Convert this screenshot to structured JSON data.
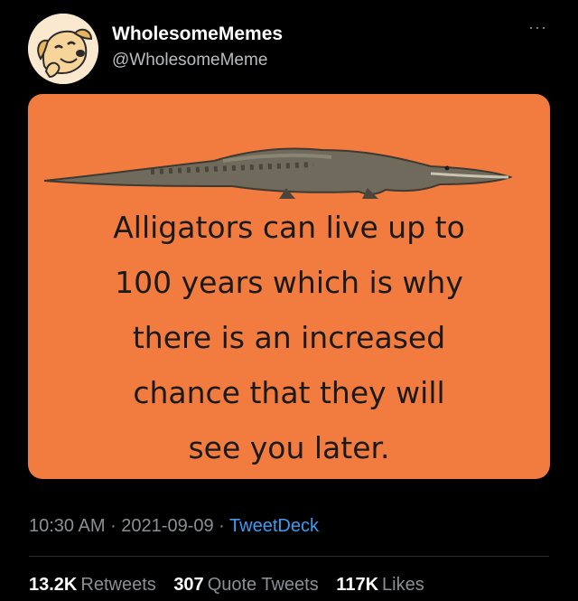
{
  "user": {
    "name": "WholesomeMemes",
    "handle": "@WholesomeMeme"
  },
  "more_label": "···",
  "meme": {
    "lines": [
      "Alligators can live up to",
      "100 years which is why",
      "there is an increased",
      "chance that they will",
      "see you later."
    ]
  },
  "meta": {
    "time": "10:30 AM",
    "sep1": " · ",
    "date": "2021-09-09",
    "sep2": " · ",
    "app": "TweetDeck"
  },
  "stats": {
    "retweets": {
      "count": "13.2K",
      "label": "Retweets"
    },
    "quotes": {
      "count": "307",
      "label": "Quote Tweets"
    },
    "likes": {
      "count": "117K",
      "label": "Likes"
    }
  },
  "colors": {
    "card_bg": "#f27c3f",
    "link": "#3b9cf0"
  }
}
